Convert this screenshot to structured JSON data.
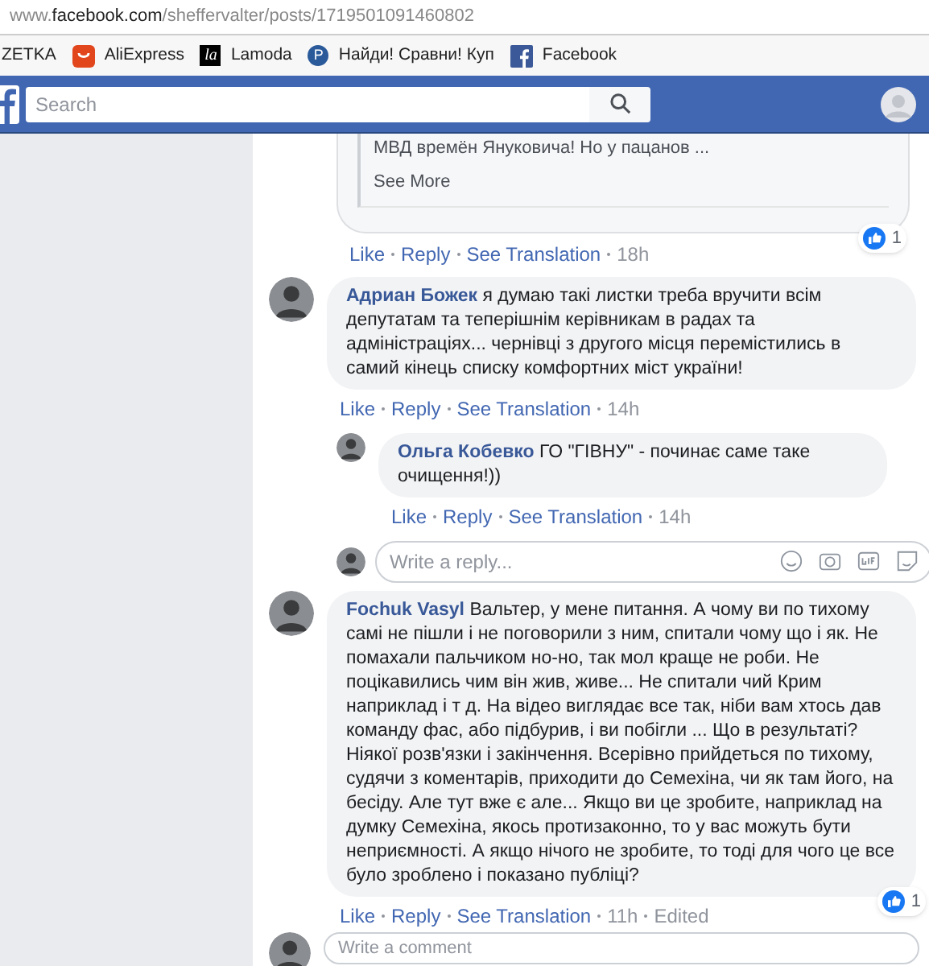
{
  "browser": {
    "url_host_prefix": "www.",
    "url_host": "facebook.com",
    "url_path": "/sheffervalter/posts/1719501091460802",
    "bookmarks": [
      {
        "kind": "text",
        "label": "ZETKA"
      },
      {
        "kind": "aliexpress",
        "label": "AliExpress"
      },
      {
        "kind": "lamoda",
        "icon_text": "la",
        "label": "Lamoda"
      },
      {
        "kind": "circle",
        "icon_text": "P",
        "label": "Найди! Сравни! Куп"
      },
      {
        "kind": "facebook",
        "label": "Facebook"
      }
    ]
  },
  "navbar": {
    "search": {
      "placeholder": "Search"
    }
  },
  "shared_card": {
    "text": "МВД времён Януковича! Но у пацанов ...",
    "link": "See More",
    "actions": [
      "Like",
      "Reply",
      "See Translation"
    ],
    "time": "18h",
    "reactions": "1"
  },
  "comments": [
    {
      "author": "Адриан Божек",
      "text": "я думаю такі листки треба вручити всім депутатам та теперішнім керівникам в радах та адміністраціях... чернівці з другого місця перемістились в самий кінець списку комфортних міст україни!",
      "actions": [
        "Like",
        "Reply",
        "See Translation"
      ],
      "time": "14h",
      "replies": [
        {
          "author": "Ольга Кобевко",
          "text": "ГО \"ГІВНУ\" - починає саме таке очищення!))",
          "actions": [
            "Like",
            "Reply",
            "See Translation"
          ],
          "time": "14h"
        }
      ],
      "reply_box": {
        "placeholder": "Write a reply..."
      }
    },
    {
      "author": "Fochuk Vasyl",
      "text": "Вальтер, у мене питання. А чому ви по тихому самі не пішли і не поговорили з ним, спитали чому що і як. Не помахали пальчиком но-но, так мол краще не роби. Не поцікавились чим він жив, живе... Не спитали чий Крим наприклад і т д. На відео виглядає все так, ніби вам хтось дав команду фас, або підбурив, і ви побігли ... Що в результаті? Ніякої розв'язки і закінчення. Всерівно прийдеться по тихому, судячи з коментарів, приходити до Семехіна, чи як там його, на бесіду. Але тут вже є але... Якщо ви це зробите, наприклад на думку Семехіна, якось протизаконно, то у вас можуть бути неприємності. А якщо нічого не зробите, то тоді для чого це все було зроблено і показано публіці?",
      "actions": [
        "Like",
        "Reply",
        "See Translation"
      ],
      "time": "11h",
      "edited": "Edited",
      "reactions": "1"
    }
  ],
  "comment_box": {
    "placeholder": "Write a comment"
  }
}
